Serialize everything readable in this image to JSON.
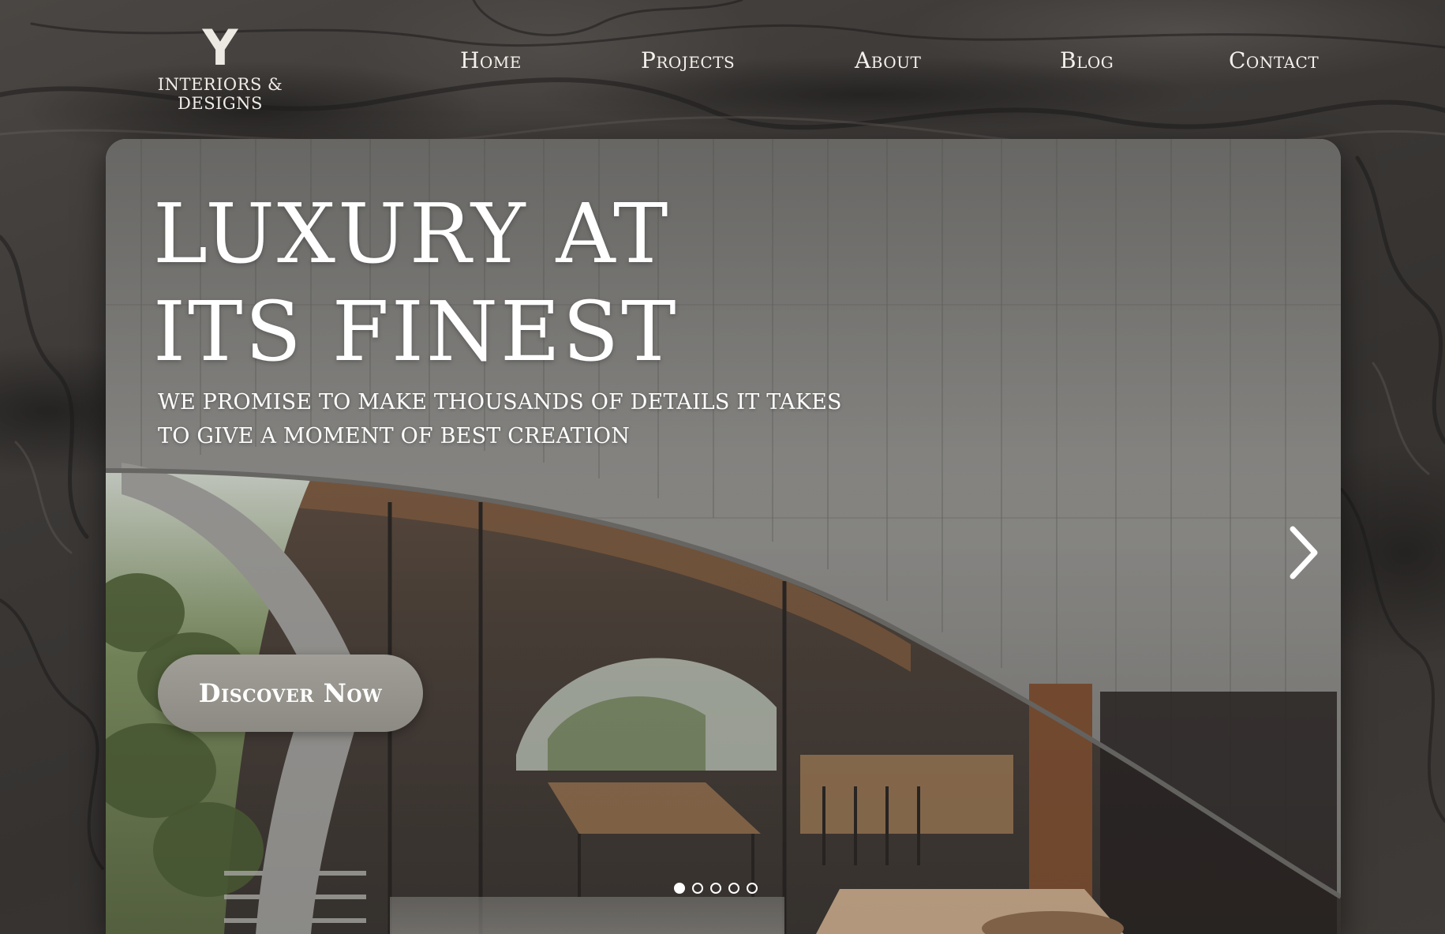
{
  "brand": {
    "mark": "Y",
    "name": "INTERIORS & DESIGNS"
  },
  "nav": {
    "items": [
      {
        "label": "Home"
      },
      {
        "label": "Projects"
      },
      {
        "label": "About"
      },
      {
        "label": "Blog"
      },
      {
        "label": "Contact"
      }
    ]
  },
  "hero": {
    "headline_line1": "LUXURY AT",
    "headline_line2": "ITS FINEST",
    "tagline_line1": "WE PROMISE TO MAKE THOUSANDS OF DETAILS IT TAKES",
    "tagline_line2": "TO GIVE A MOMENT OF BEST CREATION",
    "cta_label": "Discover Now",
    "next_icon": "chevron-right-icon",
    "carousel": {
      "slide_count": 5,
      "active_index": 0
    }
  },
  "colors": {
    "background": "#3b3836",
    "text": "#ffffff",
    "cta": "#9a9891"
  }
}
